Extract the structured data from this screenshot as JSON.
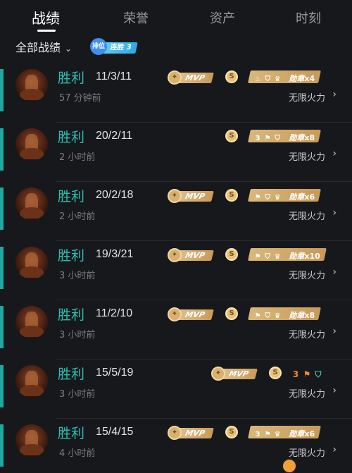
{
  "tabs": [
    {
      "label": "战绩",
      "active": true
    },
    {
      "label": "荣誉",
      "active": false
    },
    {
      "label": "资产",
      "active": false
    },
    {
      "label": "时刻",
      "active": false
    }
  ],
  "filter": {
    "label": "全部战绩",
    "chevron": "chevron-down-icon"
  },
  "rank_badge": {
    "mascot": "排位",
    "streak": "连胜 3"
  },
  "colors": {
    "win": "#2cc0b4",
    "accent_bar": "#1fa8a0",
    "gold": "#d8b070",
    "background": "#17181c"
  },
  "matches": [
    {
      "result": "胜利",
      "kda": "11/3/11",
      "time": "57 分钟前",
      "mode": "无限火力",
      "mvp": true,
      "mvp_label": "MVP",
      "coin": "S",
      "medal_text": "勋章",
      "medal_count": "x4",
      "medal_icons": [
        "flame",
        "shield",
        "crown"
      ]
    },
    {
      "result": "胜利",
      "kda": "20/2/11",
      "time": "2 小时前",
      "mode": "无限火力",
      "mvp": false,
      "mvp_label": "",
      "coin": "S",
      "medal_text": "勋章",
      "medal_count": "x8",
      "medal_icons": [
        "three",
        "flag",
        "shield"
      ]
    },
    {
      "result": "胜利",
      "kda": "20/2/18",
      "time": "2 小时前",
      "mode": "无限火力",
      "mvp": true,
      "mvp_label": "MVP",
      "coin": "S",
      "medal_text": "勋章",
      "medal_count": "x6",
      "medal_icons": [
        "flag",
        "shield",
        "crown"
      ]
    },
    {
      "result": "胜利",
      "kda": "19/3/21",
      "time": "3 小时前",
      "mode": "无限火力",
      "mvp": true,
      "mvp_label": "MVP",
      "coin": "S",
      "medal_text": "勋章",
      "medal_count": "x10",
      "medal_icons": [
        "flag",
        "shield",
        "crown"
      ]
    },
    {
      "result": "胜利",
      "kda": "11/2/10",
      "time": "3 小时前",
      "mode": "无限火力",
      "mvp": true,
      "mvp_label": "MVP",
      "coin": "S",
      "medal_text": "勋章",
      "medal_count": "x8",
      "medal_icons": [
        "flag",
        "shield",
        "crown"
      ]
    },
    {
      "result": "胜利",
      "kda": "15/5/19",
      "time": "3 小时前",
      "mode": "无限火力",
      "mvp": true,
      "mvp_label": "MVP",
      "coin": "S",
      "medal_text": "",
      "medal_count": "",
      "plain_icons": [
        "3",
        "flag",
        "shield"
      ]
    },
    {
      "result": "胜利",
      "kda": "15/4/15",
      "time": "4 小时前",
      "mode": "无限火力",
      "mvp": true,
      "mvp_label": "MVP",
      "coin": "S",
      "medal_text": "勋章",
      "medal_count": "x6",
      "medal_icons": [
        "three",
        "flag",
        "crown"
      ]
    }
  ]
}
